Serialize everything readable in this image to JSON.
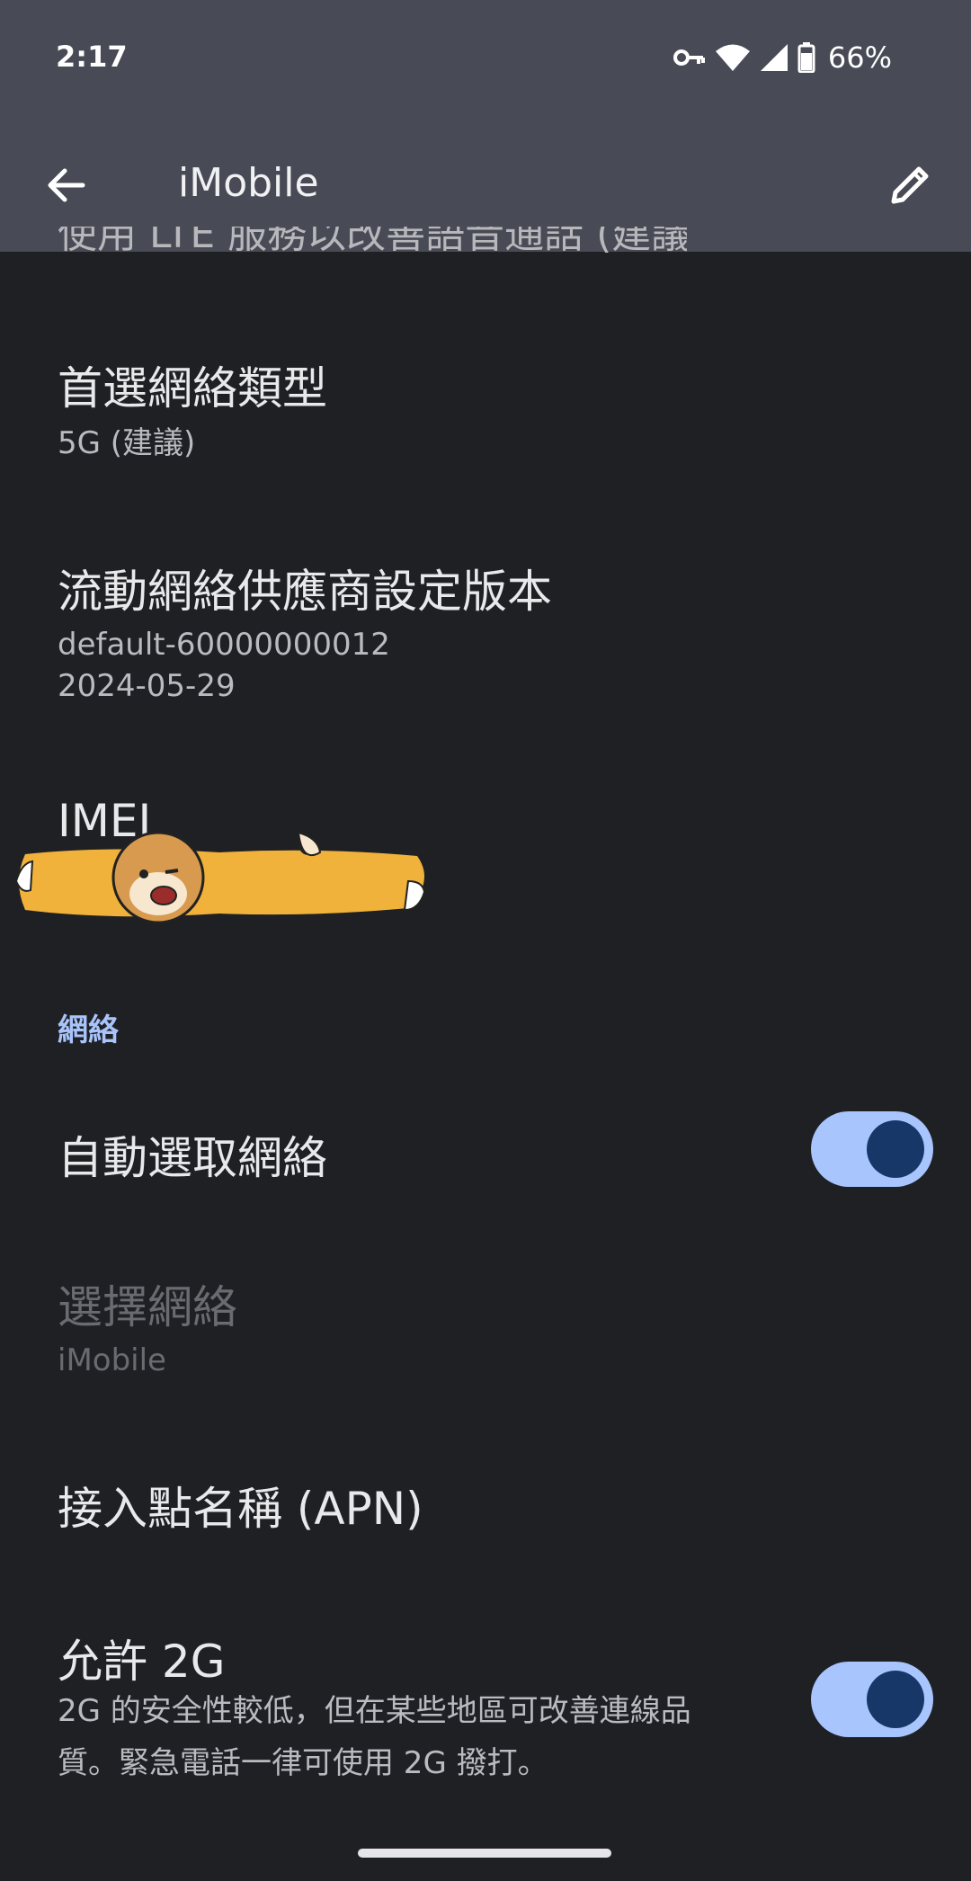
{
  "status_bar": {
    "time": "2:17",
    "icons": [
      "vpn-key-icon",
      "wifi-icon",
      "signal-icon",
      "battery-icon"
    ],
    "battery_percent": "66%"
  },
  "app_bar": {
    "title": "iMobile",
    "back_icon": "arrow-back-icon",
    "edit_icon": "pencil-icon"
  },
  "partial_row": {
    "text": "使用 LTE 服務以改善語音通話 (建議)"
  },
  "preferences": {
    "network_type": {
      "title": "首選網絡類型",
      "summary": "5G (建議)"
    },
    "carrier_version": {
      "title": "流動網絡供應商設定版本",
      "summary_line1": "default-60000000012",
      "summary_line2": "2024-05-29"
    },
    "imei": {
      "title": "IMEI"
    }
  },
  "network_section": {
    "header": "網絡",
    "auto_select": {
      "title": "自動選取網絡",
      "checked": true
    },
    "choose_network": {
      "title": "選擇網絡",
      "summary": "iMobile",
      "enabled": false
    },
    "apn": {
      "title": "接入點名稱 (APN)"
    },
    "allow_2g": {
      "title": "允許 2G",
      "summary_line1": "2G 的安全性較低，但在某些地區可改善連線品",
      "summary_line2": "質。緊急電話一律可使用 2G 撥打。",
      "checked": true
    }
  },
  "colors": {
    "background": "#1f2024",
    "app_bar": "#484b55",
    "accent": "#a9c4fa",
    "toggle_track": "#a8c6fd",
    "toggle_thumb": "#163768"
  }
}
